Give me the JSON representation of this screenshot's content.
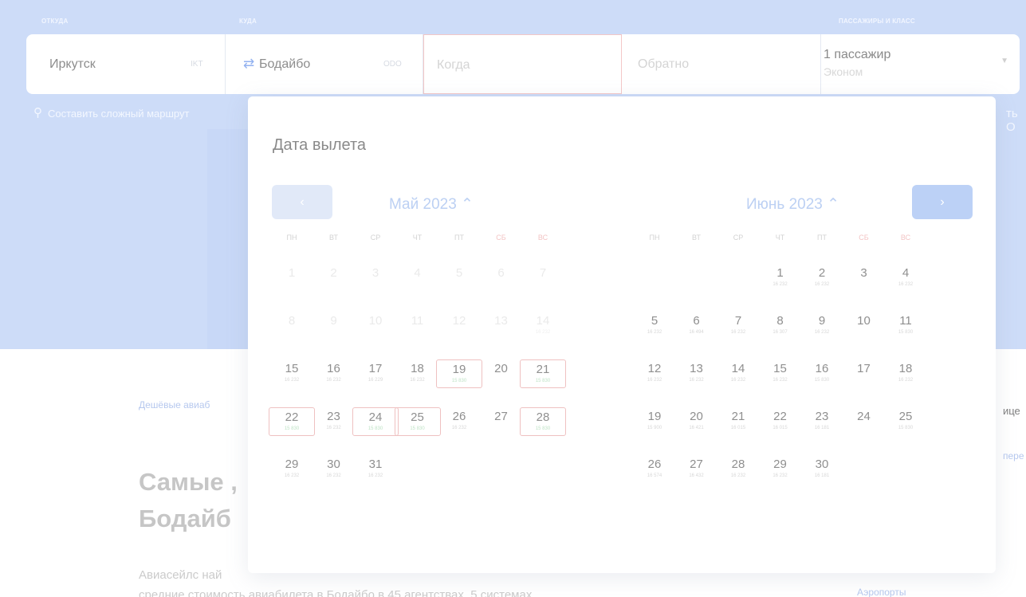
{
  "search": {
    "labels": {
      "from": "ОТКУДА",
      "to": "КУДА",
      "passengers": "ПАССАЖИРЫ И КЛАСС"
    },
    "from_city": "Иркутск",
    "from_code": "IKT",
    "to_city": "Бодайбо",
    "to_code": "ODO",
    "depart_placeholder": "Когда",
    "return_placeholder": "Обратно",
    "passengers": "1 пассажир",
    "class": "Эконом",
    "complex_route": "Составить сложный маршрут",
    "cut_right": "ть О"
  },
  "calendar": {
    "title": "Дата вылета",
    "weekdays": [
      "ПН",
      "ВТ",
      "СР",
      "ЧТ",
      "ПТ",
      "СБ",
      "ВС"
    ],
    "months": [
      {
        "title": "Май 2023 ⌃",
        "days": [
          {
            "d": "1",
            "p": "",
            "dim": true
          },
          {
            "d": "2",
            "p": "",
            "dim": true
          },
          {
            "d": "3",
            "p": "",
            "dim": true
          },
          {
            "d": "4",
            "p": "",
            "dim": true
          },
          {
            "d": "5",
            "p": "",
            "dim": true
          },
          {
            "d": "6",
            "p": "",
            "dim": true
          },
          {
            "d": "7",
            "p": "",
            "dim": true
          },
          {
            "d": "8",
            "p": "",
            "dim": true
          },
          {
            "d": "9",
            "p": "",
            "dim": true
          },
          {
            "d": "10",
            "p": "",
            "dim": true
          },
          {
            "d": "11",
            "p": "",
            "dim": true
          },
          {
            "d": "12",
            "p": "",
            "dim": true
          },
          {
            "d": "13",
            "p": "",
            "dim": true
          },
          {
            "d": "14",
            "p": "16 232",
            "dim": true
          },
          {
            "d": "15",
            "p": "16 232"
          },
          {
            "d": "16",
            "p": "16 232"
          },
          {
            "d": "17",
            "p": "16 229"
          },
          {
            "d": "18",
            "p": "16 232"
          },
          {
            "d": "19",
            "p": "15 830",
            "cheap": true
          },
          {
            "d": "20",
            "p": ""
          },
          {
            "d": "21",
            "p": "15 830",
            "cheap": true
          },
          {
            "d": "22",
            "p": "15 830",
            "cheap": true
          },
          {
            "d": "23",
            "p": "16 232"
          },
          {
            "d": "24",
            "p": "15 830",
            "cheap": true
          },
          {
            "d": "25",
            "p": "15 830",
            "cheap": true
          },
          {
            "d": "26",
            "p": "16 232"
          },
          {
            "d": "27",
            "p": ""
          },
          {
            "d": "28",
            "p": "15 830",
            "cheap": true
          },
          {
            "d": "29",
            "p": "16 232"
          },
          {
            "d": "30",
            "p": "16 232"
          },
          {
            "d": "31",
            "p": "16 232"
          }
        ]
      },
      {
        "title": "Июнь 2023 ⌃",
        "days": [
          {
            "d": "1",
            "p": "16 232"
          },
          {
            "d": "2",
            "p": "16 232"
          },
          {
            "d": "3",
            "p": ""
          },
          {
            "d": "4",
            "p": "16 232"
          },
          {
            "d": "5",
            "p": "16 232"
          },
          {
            "d": "6",
            "p": "16 494"
          },
          {
            "d": "7",
            "p": "16 232"
          },
          {
            "d": "8",
            "p": "16 307"
          },
          {
            "d": "9",
            "p": "16 232"
          },
          {
            "d": "10",
            "p": ""
          },
          {
            "d": "11",
            "p": "15 830"
          },
          {
            "d": "12",
            "p": "16 232"
          },
          {
            "d": "13",
            "p": "16 232"
          },
          {
            "d": "14",
            "p": "16 232"
          },
          {
            "d": "15",
            "p": "16 232"
          },
          {
            "d": "16",
            "p": "15 830"
          },
          {
            "d": "17",
            "p": ""
          },
          {
            "d": "18",
            "p": "16 232"
          },
          {
            "d": "19",
            "p": "15 900"
          },
          {
            "d": "20",
            "p": "16 421"
          },
          {
            "d": "21",
            "p": "16 015"
          },
          {
            "d": "22",
            "p": "16 015"
          },
          {
            "d": "23",
            "p": "16 181"
          },
          {
            "d": "24",
            "p": ""
          },
          {
            "d": "25",
            "p": "15 830"
          },
          {
            "d": "26",
            "p": "16 574"
          },
          {
            "d": "27",
            "p": "16 432"
          },
          {
            "d": "28",
            "p": "16 232"
          },
          {
            "d": "29",
            "p": "16 232"
          },
          {
            "d": "30",
            "p": "16 181"
          }
        ]
      }
    ]
  },
  "page": {
    "cheap_link": "Дешёвые авиаб",
    "title_line1": "Самые ,",
    "title_line2": "Бодайб",
    "text_line1": "Авиасейлс най",
    "text_line2": "средние стоимость авиабилета в Бодайбо в 45 агентствах, 5 системах",
    "right_1": "ице",
    "right_2": "пере",
    "airports": "Аэропорты"
  },
  "colors": {
    "hero_bg": "#cddcf8",
    "accent_blue": "#bcd1f6",
    "cheap_border": "#efc1c1"
  }
}
